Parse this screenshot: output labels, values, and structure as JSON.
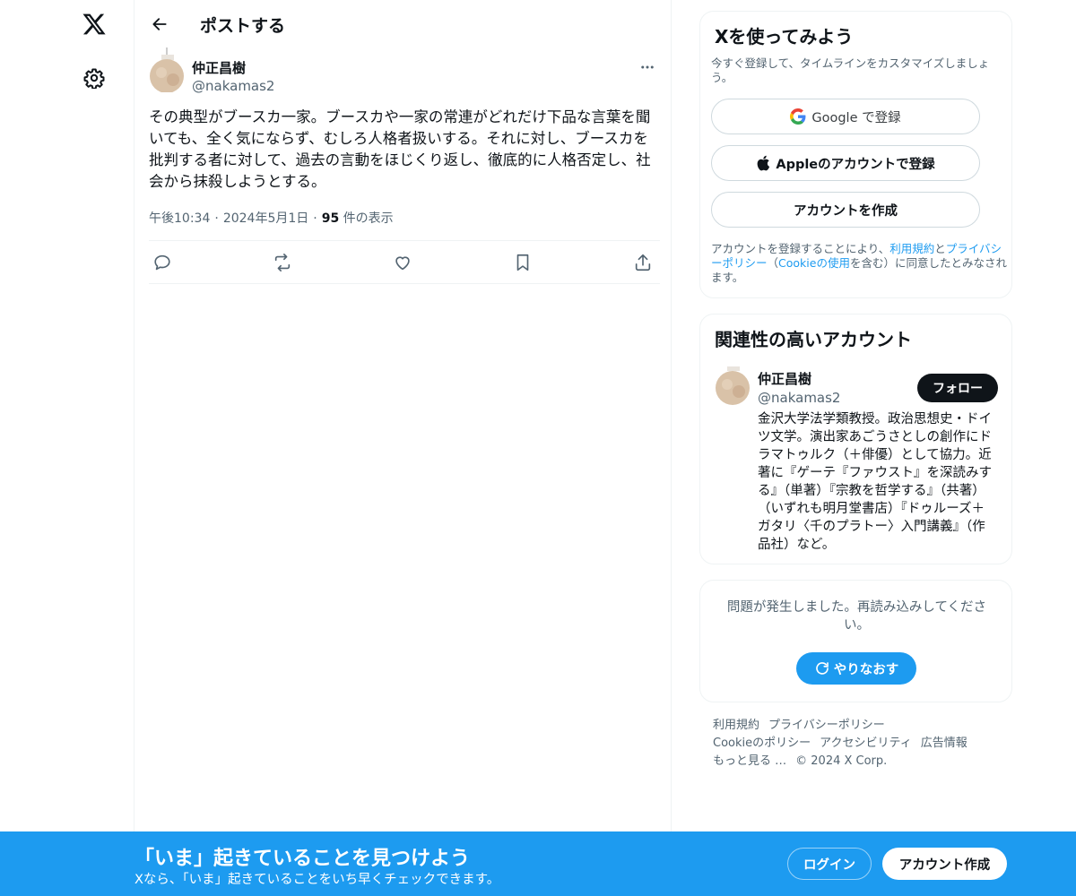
{
  "nav": {
    "logo_icon": "x-logo-icon",
    "settings_icon": "gear-icon"
  },
  "header": {
    "title": "ポストする",
    "back_icon": "arrow-left-icon"
  },
  "post": {
    "author_name": "仲正昌樹",
    "author_handle": "@nakamas2",
    "text": "その典型がブースカ一家。ブースカや一家の常連がどれだけ下品な言葉を聞いても、全く気にならず、むしろ人格者扱いする。それに対し、ブースカを批判する者に対して、過去の言動をほじくり返し、徹底的に人格否定し、社会から抹殺しようとする。",
    "time": "午後10:34",
    "date": "2024年5月1日",
    "views_count": "95",
    "views_label": " 件の表示"
  },
  "signup_card": {
    "title": "Xを使ってみよう",
    "subtitle": "今すぐ登録して、タイムラインをカスタマイズしましょう。",
    "google_label": "Google で登録",
    "apple_label": "Appleのアカウントで登録",
    "create_label": "アカウントを作成",
    "legal_prefix": "アカウントを登録することにより、",
    "legal_terms": "利用規約",
    "legal_and": "と",
    "legal_privacy": "プライバシーポリシー",
    "legal_paren_open": "（",
    "legal_cookie": "Cookieの使用",
    "legal_suffix": "を含む）に同意したとみなされます。"
  },
  "related_card": {
    "title": "関連性の高いアカウント",
    "name": "仲正昌樹",
    "handle": "@nakamas2",
    "follow_label": "フォロー",
    "bio": "金沢大学法学類教授。政治思想史・ドイツ文学。演出家あごうさとしの創作にドラマトゥルク（＋俳優）として協力。近著に『ゲーテ『ファウスト』を深読みする』（単著）『宗教を哲学する』（共著）（いずれも明月堂書店）『ドゥルーズ＋ガタリ〈千のプラトー〉入門講義』（作品社）など。"
  },
  "error_card": {
    "message": "問題が発生しました。再読み込みしてください。",
    "retry_label": "やりなおす"
  },
  "footer": {
    "links": [
      "利用規約",
      "プライバシーポリシー",
      "Cookieのポリシー",
      "アクセシビリティ",
      "広告情報",
      "もっと見る …",
      "© 2024 X Corp."
    ]
  },
  "banner": {
    "title": "「いま」起きていることを見つけよう",
    "subtitle": "Xなら、「いま」起きていることをいち早くチェックできます。",
    "login_label": "ログイン",
    "signup_label": "アカウント作成"
  },
  "colors": {
    "accent": "#1d9bf0",
    "text": "#0f1419",
    "muted": "#536471",
    "border": "#eff3f4"
  }
}
